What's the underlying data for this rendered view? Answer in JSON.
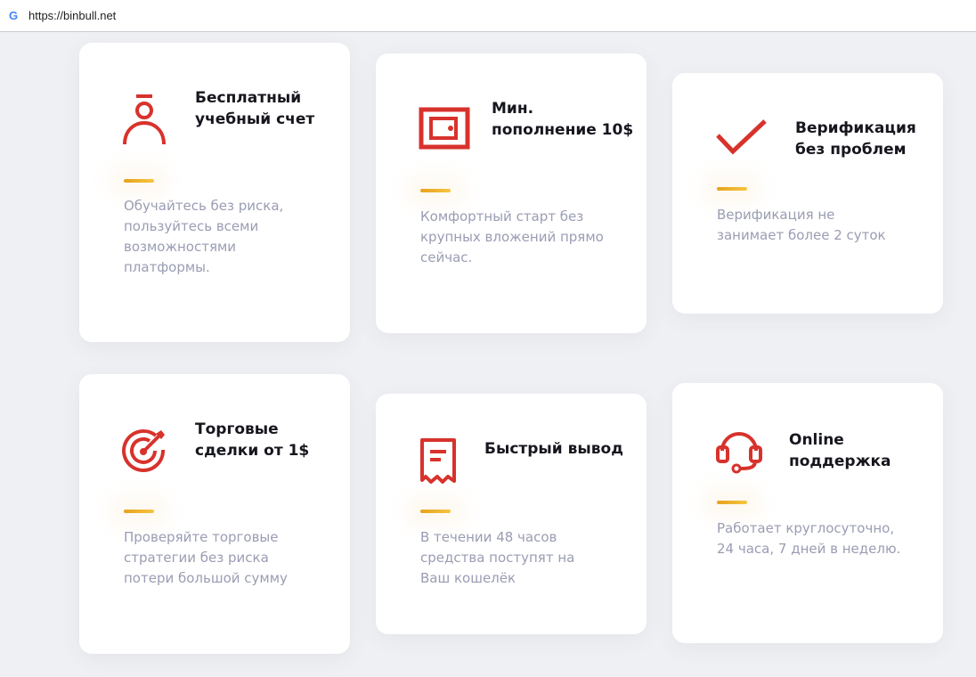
{
  "browser": {
    "url": "https://binbull.net",
    "favicon": "G"
  },
  "accent": "#d8322c",
  "bar_color": "#f0b529",
  "cards": [
    {
      "icon": "person-icon",
      "title": "Бесплатный учебный счет",
      "desc": "Обучайтесь без риска, пользуйтесь всеми возможностями платформы."
    },
    {
      "icon": "wallet-icon",
      "title": "Мин. пополнение 10$",
      "desc": "Комфортный старт без крупных вложений прямо сейчас."
    },
    {
      "icon": "checkmark-icon",
      "title": "Верификация без проблем",
      "desc": "Верификация не занимает более 2 суток"
    },
    {
      "icon": "target-icon",
      "title": "Торговые сделки от 1$",
      "desc": "Проверяйте торговые стратегии без риска потери большой сумму"
    },
    {
      "icon": "receipt-icon",
      "title": "Быстрый вывод",
      "desc": "В течении 48 часов средства поступят на Ваш кошелёк"
    },
    {
      "icon": "headset-icon",
      "title": "Online поддержка",
      "desc": "Работает круглосуточно, 24 часа, 7 дней в неделю."
    }
  ]
}
